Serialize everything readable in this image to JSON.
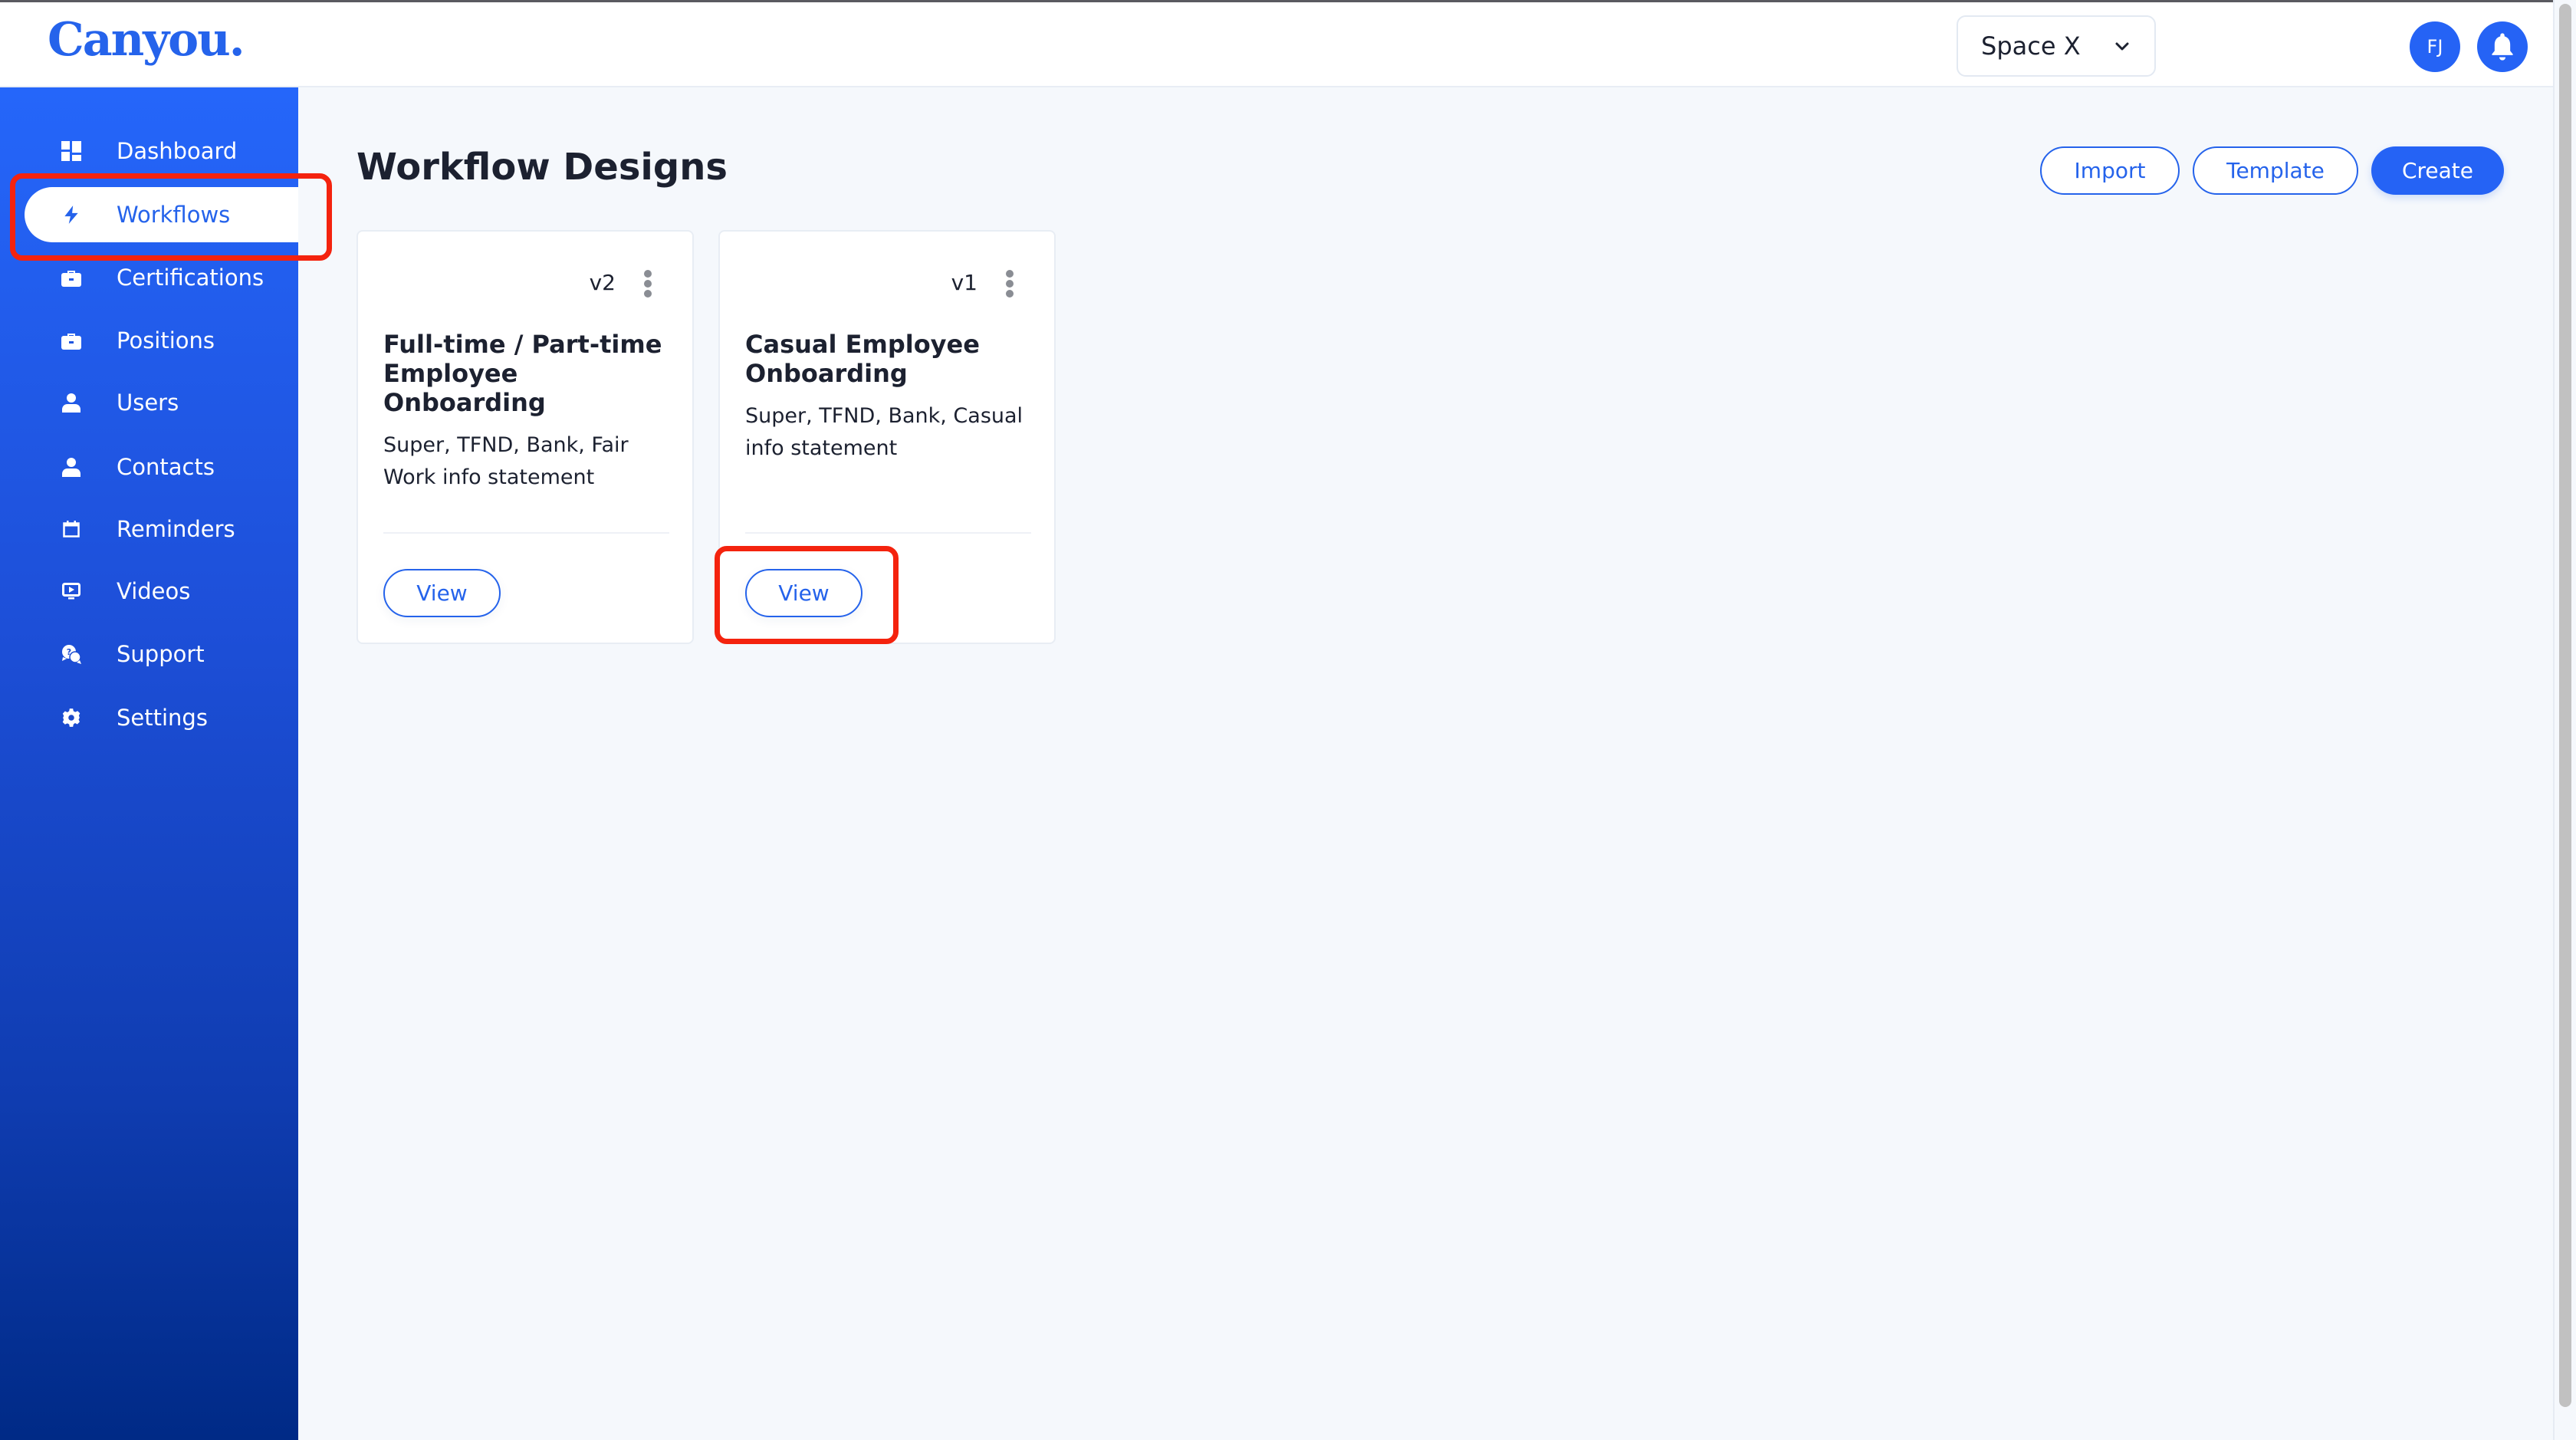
{
  "header": {
    "logo": "Canyou.",
    "space_selector": {
      "value": "Space X"
    },
    "avatar_initials": "FJ",
    "notifications_icon": "bell-icon"
  },
  "sidebar": {
    "items": [
      {
        "label": "Dashboard",
        "icon": "dashboard-icon",
        "active": false
      },
      {
        "label": "Workflows",
        "icon": "bolt-icon",
        "active": true
      },
      {
        "label": "Certifications",
        "icon": "briefcase-icon",
        "active": false
      },
      {
        "label": "Positions",
        "icon": "briefcase-icon",
        "active": false
      },
      {
        "label": "Users",
        "icon": "user-icon",
        "active": false
      },
      {
        "label": "Contacts",
        "icon": "user-icon",
        "active": false
      },
      {
        "label": "Reminders",
        "icon": "calendar-icon",
        "active": false
      },
      {
        "label": "Videos",
        "icon": "video-icon",
        "active": false
      },
      {
        "label": "Support",
        "icon": "support-chat-icon",
        "active": false
      },
      {
        "label": "Settings",
        "icon": "gear-icon",
        "active": false
      }
    ]
  },
  "main": {
    "title": "Workflow Designs",
    "actions": {
      "import_label": "Import",
      "template_label": "Template",
      "create_label": "Create"
    },
    "cards": [
      {
        "version": "v2",
        "title": "Full-time / Part-time Employee Onboarding",
        "description": "Super, TFND, Bank, Fair Work info statement",
        "view_label": "View"
      },
      {
        "version": "v1",
        "title": "Casual Employee Onboarding",
        "description": "Super, TFND, Bank, Casual info statement",
        "view_label": "View"
      }
    ]
  },
  "colors": {
    "brand": "#2563eb",
    "sidebar_top": "#2566fa",
    "sidebar_bottom": "#002a86",
    "background": "#f5f8fc",
    "annotation": "#f4230e"
  }
}
